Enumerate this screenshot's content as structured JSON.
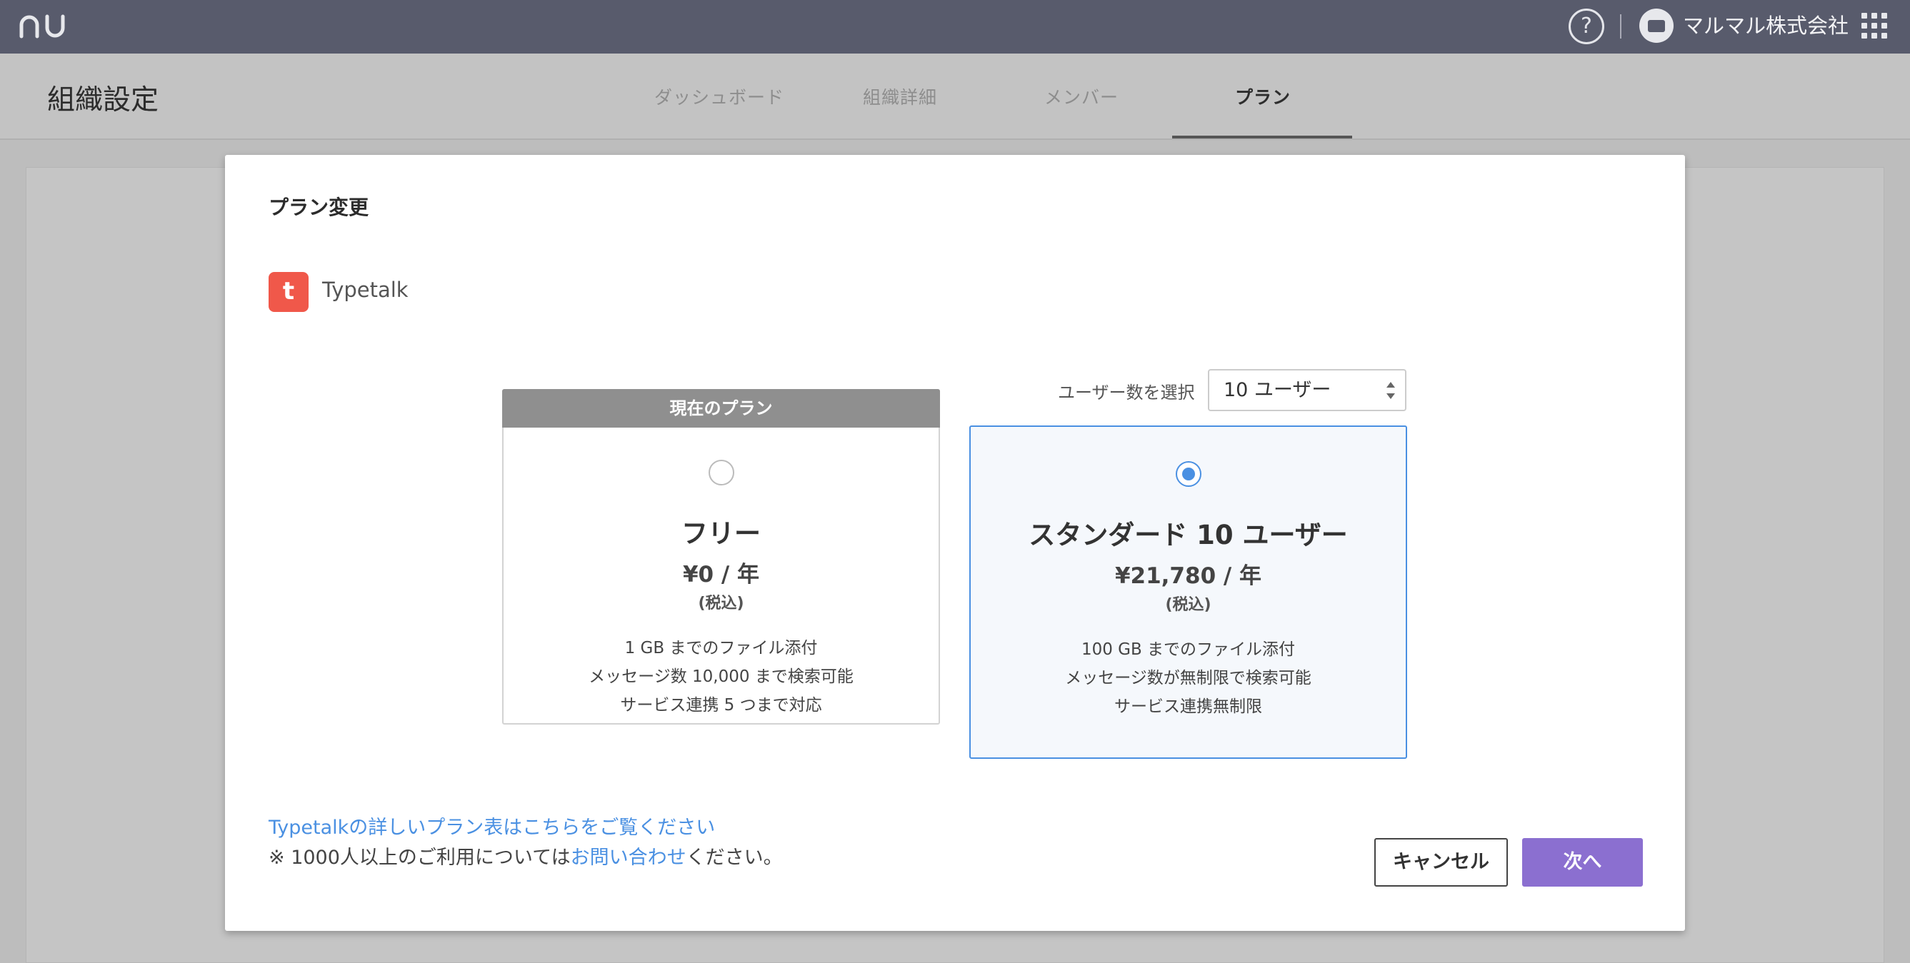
{
  "topbar": {
    "help_glyph": "?",
    "org_name": "マルマル株式会社"
  },
  "subheader": {
    "title": "組織設定",
    "tabs": [
      {
        "label": "ダッシュボード",
        "active": false
      },
      {
        "label": "組織詳細",
        "active": false
      },
      {
        "label": "メンバー",
        "active": false
      },
      {
        "label": "プラン",
        "active": true
      }
    ]
  },
  "modal": {
    "title": "プラン変更",
    "product": {
      "icon_glyph": "t",
      "name": "Typetalk",
      "icon_color": "#f0584a"
    },
    "user_select": {
      "label": "ユーザー数を選択",
      "value": "10 ユーザー"
    },
    "plans": [
      {
        "badge": "現在のプラン",
        "name": "フリー",
        "price": "¥0 / 年",
        "tax": "(税込)",
        "selected": false,
        "features": [
          "1 GB までのファイル添付",
          "メッセージ数 10,000 まで検索可能",
          "サービス連携 5 つまで対応"
        ]
      },
      {
        "name": "スタンダード 10 ユーザー",
        "price": "¥21,780 / 年",
        "tax": "(税込)",
        "selected": true,
        "features": [
          "100 GB までのファイル添付",
          "メッセージ数が無制限で検索可能",
          "サービス連携無制限"
        ]
      }
    ],
    "plan_link": "Typetalkの詳しいプラン表はこちらをご覧ください",
    "note": {
      "prefix": "※ 1000人以上のご利用については",
      "link": "お問い合わせ",
      "suffix": "ください。"
    },
    "buttons": {
      "cancel": "キャンセル",
      "next": "次へ"
    }
  },
  "colors": {
    "topbar": "#585b6c",
    "accent_blue": "#4a90e2",
    "primary_purple": "#8b6fd0",
    "product_red": "#f0584a"
  }
}
